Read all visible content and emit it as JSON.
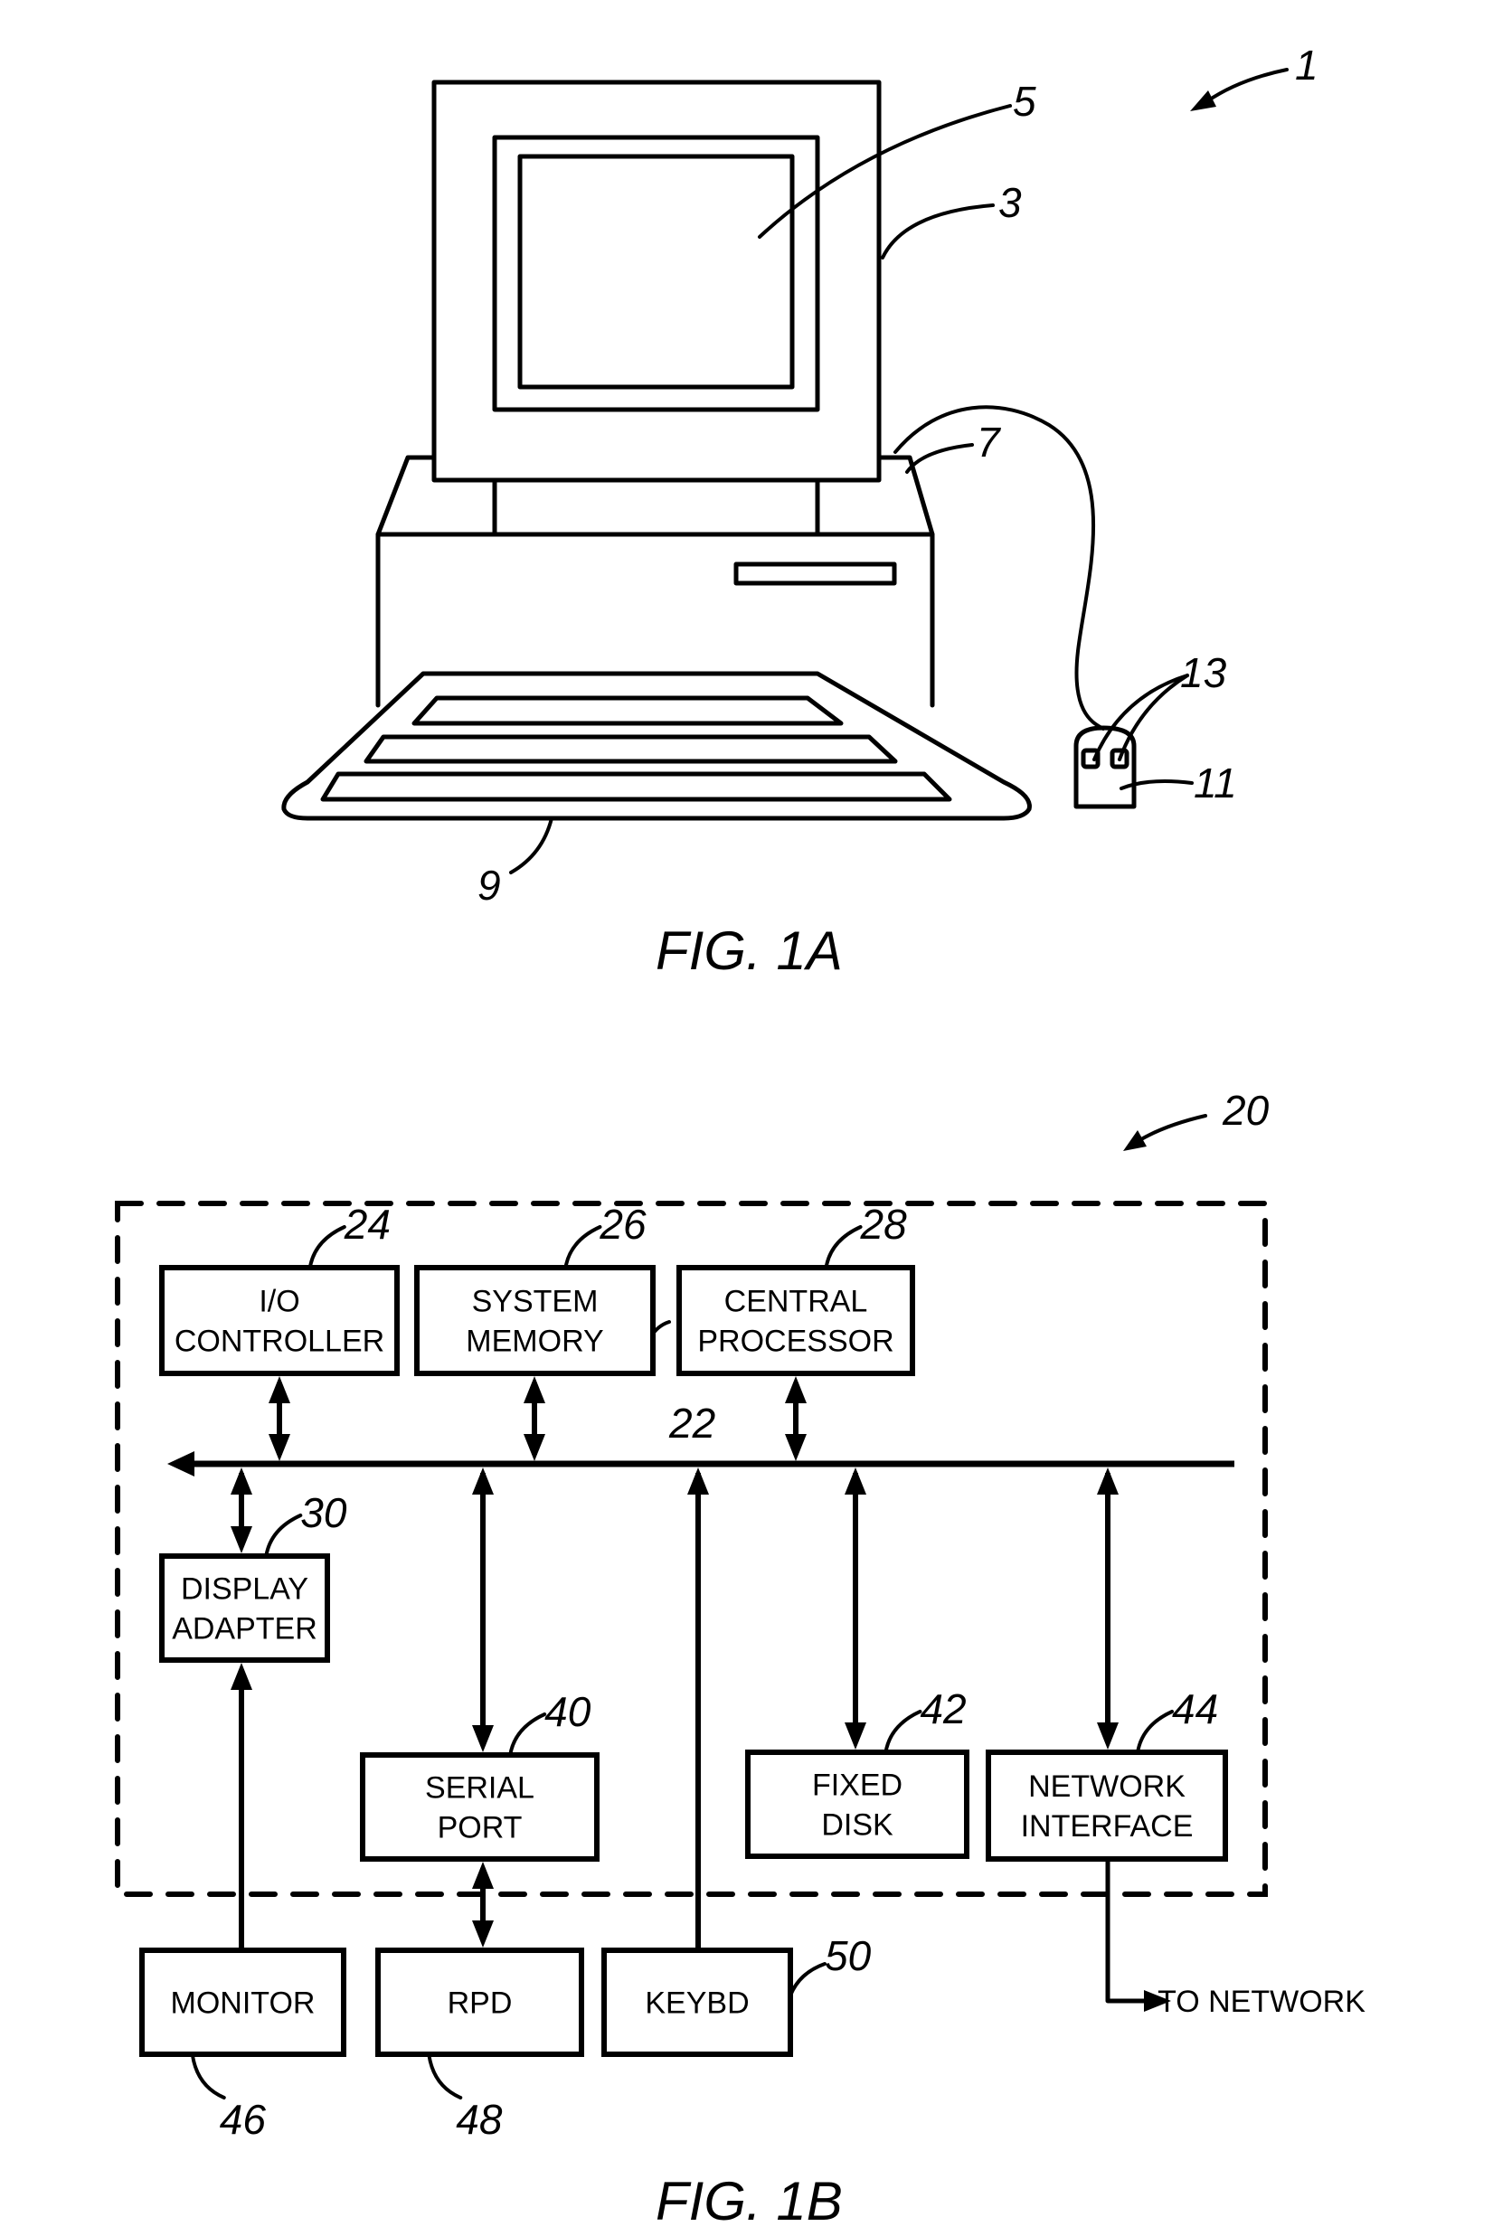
{
  "figure_1a": {
    "caption": "FIG. 1A",
    "refs": {
      "system": "1",
      "monitor": "3",
      "screen": "5",
      "cabinet": "7",
      "keyboard": "9",
      "mouse": "11",
      "mouse_buttons": "13"
    }
  },
  "figure_1b": {
    "caption": "FIG. 1B",
    "system_ref": "20",
    "bus_ref": "22",
    "blocks": {
      "io_controller": {
        "ref": "24",
        "lines": [
          "I/O",
          "CONTROLLER"
        ]
      },
      "system_memory": {
        "ref": "26",
        "lines": [
          "SYSTEM",
          "MEMORY"
        ]
      },
      "central_processor": {
        "ref": "28",
        "lines": [
          "CENTRAL",
          "PROCESSOR"
        ]
      },
      "display_adapter": {
        "ref": "30",
        "lines": [
          "DISPLAY",
          "ADAPTER"
        ]
      },
      "serial_port": {
        "ref": "40",
        "lines": [
          "SERIAL",
          "PORT"
        ]
      },
      "fixed_disk": {
        "ref": "42",
        "lines": [
          "FIXED",
          "DISK"
        ]
      },
      "network_interface": {
        "ref": "44",
        "lines": [
          "NETWORK",
          "INTERFACE"
        ]
      },
      "monitor": {
        "ref": "46",
        "lines": [
          "MONITOR"
        ]
      },
      "rpd": {
        "ref": "48",
        "lines": [
          "RPD"
        ]
      },
      "keybd": {
        "ref": "50",
        "lines": [
          "KEYBD"
        ]
      }
    },
    "network_label": "TO NETWORK"
  }
}
